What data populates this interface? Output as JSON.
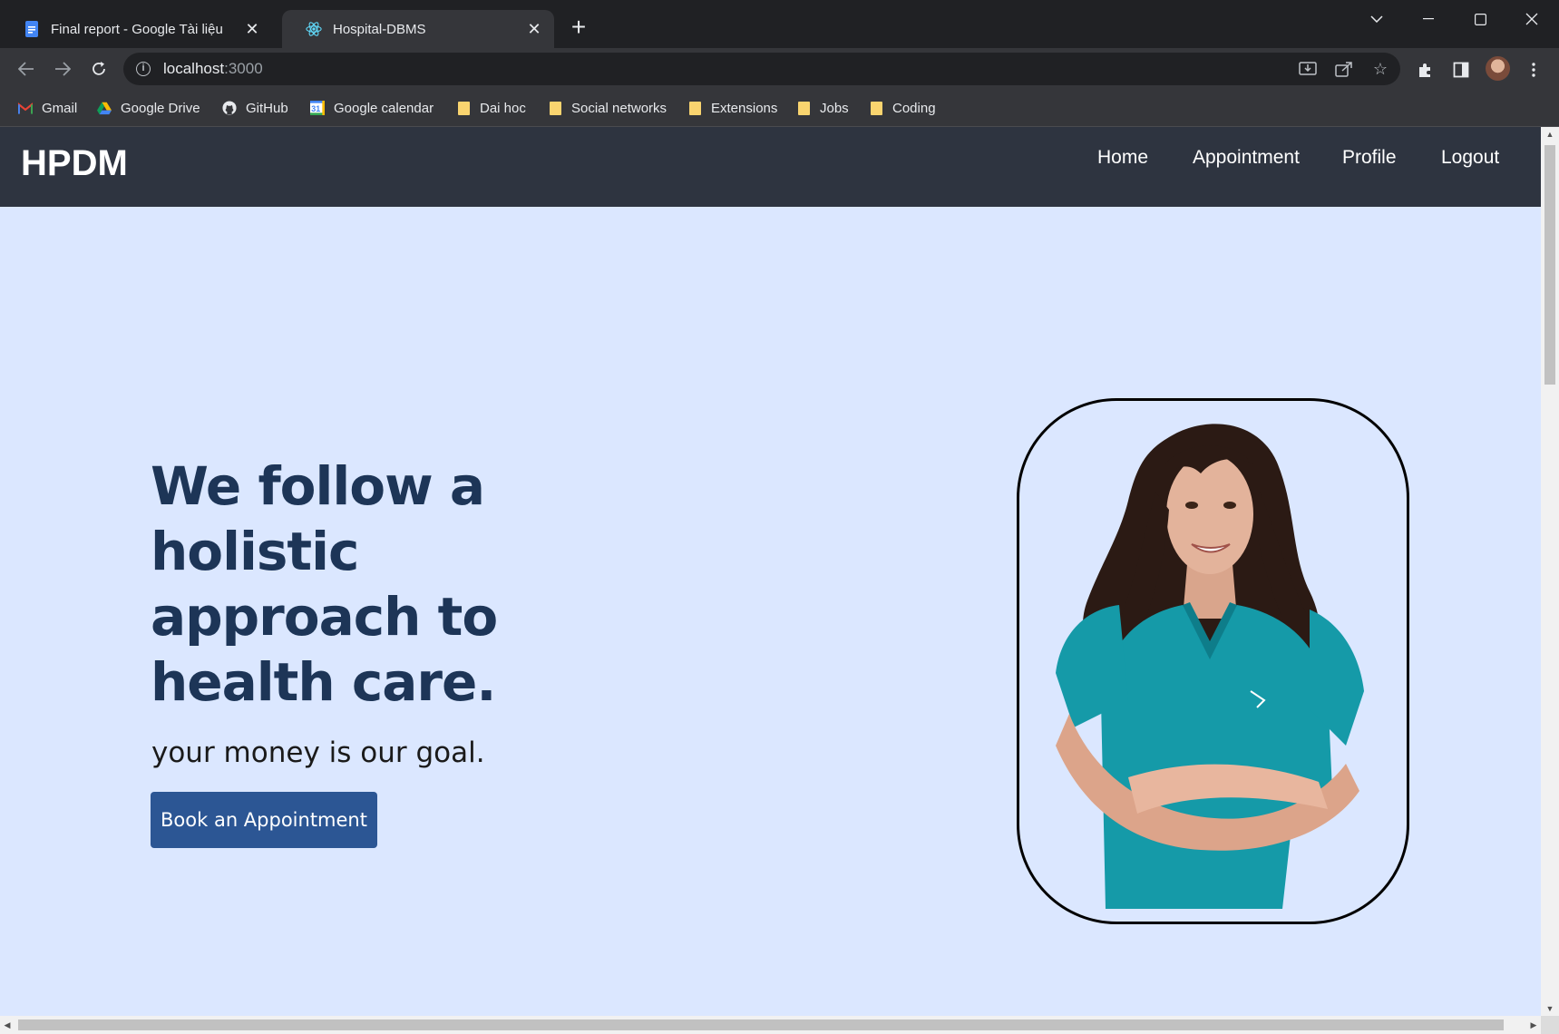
{
  "browser": {
    "tabs": [
      {
        "title": "Final report - Google Tài liệu",
        "icon": "google-docs-icon"
      },
      {
        "title": "Hospital-DBMS",
        "icon": "react-icon"
      }
    ],
    "address": {
      "host": "localhost",
      "port": ":3000"
    },
    "bookmarks": [
      {
        "label": "Gmail",
        "icon": "gmail-icon"
      },
      {
        "label": "Google Drive",
        "icon": "google-drive-icon"
      },
      {
        "label": "GitHub",
        "icon": "github-icon"
      },
      {
        "label": "Google calendar",
        "icon": "google-calendar-icon"
      },
      {
        "label": "Dai hoc",
        "icon": "folder-icon"
      },
      {
        "label": "Social networks",
        "icon": "folder-icon"
      },
      {
        "label": "Extensions",
        "icon": "folder-icon"
      },
      {
        "label": "Jobs",
        "icon": "folder-icon"
      },
      {
        "label": "Coding",
        "icon": "folder-icon"
      }
    ],
    "calendar_day": "31"
  },
  "site": {
    "logo": "HPDM",
    "nav": [
      "Home",
      "Appointment",
      "Profile",
      "Logout"
    ],
    "hero": {
      "title": "We follow a holistic approach to health care.",
      "subtitle": "your money is our goal.",
      "cta": "Book an Appointment"
    },
    "colors": {
      "navbar": "#2e3440",
      "background": "#dbe7ff",
      "heading": "#1d3557",
      "button": "#2c5694",
      "scrub": "#159aa8"
    }
  }
}
